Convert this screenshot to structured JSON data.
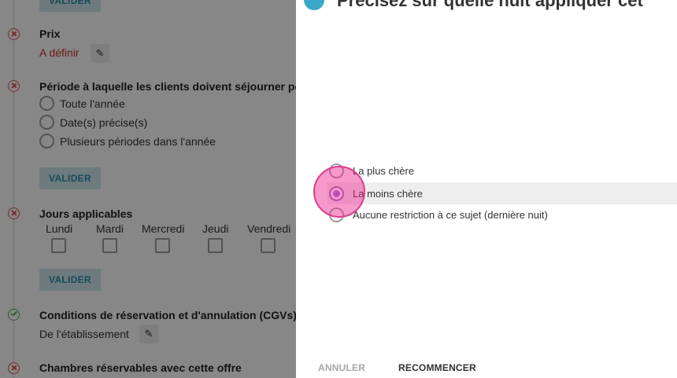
{
  "background_form": {
    "top_valider": "VALIDER",
    "prix": {
      "title": "Prix",
      "value": "A définir"
    },
    "periode": {
      "title": "Période à laquelle les clients doivent séjourner pour",
      "options": [
        "Toute l'année",
        "Date(s) précise(s)",
        "Plusieurs périodes dans l'année"
      ],
      "valider": "VALIDER"
    },
    "jours": {
      "title": "Jours applicables",
      "days": [
        "Lundi",
        "Mardi",
        "Mercredi",
        "Jeudi",
        "Vendredi"
      ],
      "valider": "VALIDER"
    },
    "conditions": {
      "title": "Conditions de réservation et d'annulation (CGVs) app",
      "value": "De l'établissement"
    },
    "chambres": {
      "title": "Chambres réservables avec cette offre"
    }
  },
  "dialog": {
    "title": "Précisez sur quelle nuit appliquer cet",
    "options": [
      {
        "label": "La plus chère",
        "selected": false
      },
      {
        "label": "La moins chère",
        "selected": true
      },
      {
        "label": "Aucune restriction à ce sujet (dernière nuit)",
        "selected": false
      }
    ],
    "cancel_label": "ANNULER",
    "restart_label": "RECOMMENCER"
  },
  "colors": {
    "accent": "#3aa9c9",
    "error": "#e0574f",
    "success": "#4caf50",
    "radio_selected": "#9575cd",
    "click_indicator": "#e23c8c"
  },
  "icons": [
    "edit-pencil-icon",
    "error-circle-icon",
    "check-circle-icon"
  ]
}
